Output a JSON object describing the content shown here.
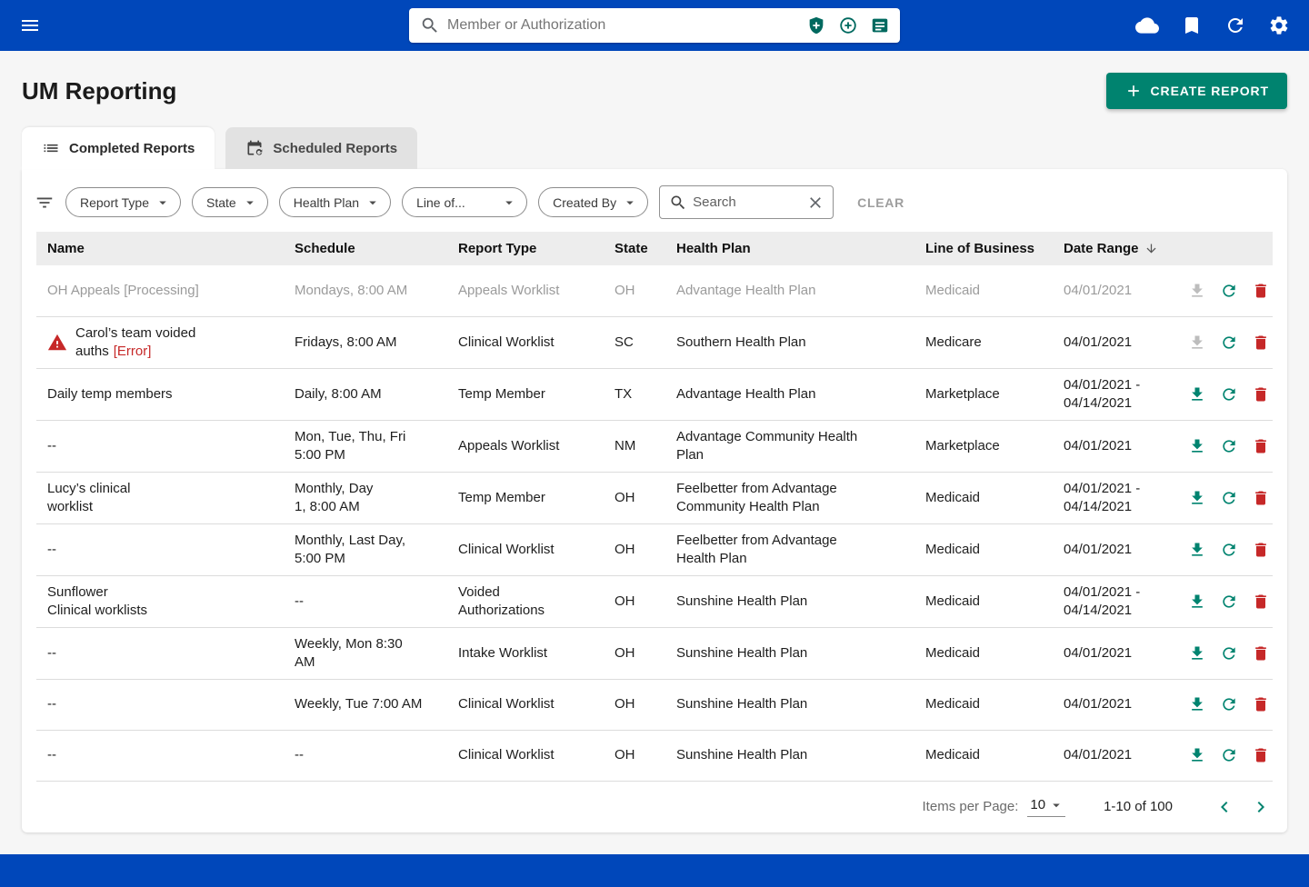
{
  "colors": {
    "topbar_blue": "#0047BA",
    "accent_green": "#00836F",
    "danger_red": "#C62828"
  },
  "topbar": {
    "search_placeholder": "Member or Authorization"
  },
  "page": {
    "title": "UM Reporting",
    "create_report_label": "CREATE REPORT"
  },
  "tabs": [
    {
      "label": "Completed Reports",
      "active": true
    },
    {
      "label": "Scheduled Reports",
      "active": false
    }
  ],
  "filters": {
    "pills": [
      "Report Type",
      "State",
      "Health Plan",
      "Line of...",
      "Created By"
    ],
    "search_placeholder": "Search",
    "clear_label": "CLEAR"
  },
  "table": {
    "headers": [
      "Name",
      "Schedule",
      "Report Type",
      "State",
      "Health Plan",
      "Line of Business",
      "Date Range"
    ],
    "rows": [
      {
        "name": "OH Appeals [Processing]",
        "error_label": "",
        "warning": false,
        "muted": true,
        "schedule": "Mondays, 8:00 AM",
        "report_type": "Appeals Worklist",
        "state": "OH",
        "health_plan": "Advantage Health Plan",
        "lob": "Medicaid",
        "date_range": "04/01/2021",
        "download_enabled": false
      },
      {
        "name": "Carol’s team voided\nauths",
        "error_label": "[Error]",
        "warning": true,
        "muted": false,
        "schedule": "Fridays, 8:00 AM",
        "report_type": "Clinical Worklist",
        "state": "SC",
        "health_plan": "Southern Health Plan",
        "lob": "Medicare",
        "date_range": "04/01/2021",
        "download_enabled": false
      },
      {
        "name": "Daily temp members",
        "error_label": "",
        "warning": false,
        "muted": false,
        "schedule": "Daily, 8:00 AM",
        "report_type": "Temp Member",
        "state": "TX",
        "health_plan": "Advantage Health Plan",
        "lob": "Marketplace",
        "date_range": "04/01/2021 -\n04/14/2021",
        "download_enabled": true
      },
      {
        "name": "--",
        "error_label": "",
        "warning": false,
        "muted": false,
        "schedule": "Mon, Tue, Thu, Fri\n5:00 PM",
        "report_type": "Appeals Worklist",
        "state": "NM",
        "health_plan": "Advantage Community Health\nPlan",
        "lob": "Marketplace",
        "date_range": "04/01/2021",
        "download_enabled": true
      },
      {
        "name": "Lucy’s clinical\nworklist",
        "error_label": "",
        "warning": false,
        "muted": false,
        "schedule": "Monthly, Day\n1, 8:00 AM",
        "report_type": "Temp Member",
        "state": "OH",
        "health_plan": "Feelbetter from Advantage\nCommunity Health Plan",
        "lob": "Medicaid",
        "date_range": "04/01/2021 -\n04/14/2021",
        "download_enabled": true
      },
      {
        "name": "--",
        "error_label": "",
        "warning": false,
        "muted": false,
        "schedule": "Monthly, Last Day,\n5:00 PM",
        "report_type": "Clinical Worklist",
        "state": "OH",
        "health_plan": "Feelbetter from Advantage\nHealth Plan",
        "lob": "Medicaid",
        "date_range": "04/01/2021",
        "download_enabled": true
      },
      {
        "name": "Sunflower\nClinical worklists",
        "error_label": "",
        "warning": false,
        "muted": false,
        "schedule": "--",
        "report_type": "Voided\nAuthorizations",
        "state": "OH",
        "health_plan": "Sunshine Health Plan",
        "lob": "Medicaid",
        "date_range": "04/01/2021 -\n04/14/2021",
        "download_enabled": true
      },
      {
        "name": "--",
        "error_label": "",
        "warning": false,
        "muted": false,
        "schedule": "Weekly, Mon 8:30\nAM",
        "report_type": "Intake Worklist",
        "state": "OH",
        "health_plan": "Sunshine Health Plan",
        "lob": "Medicaid",
        "date_range": "04/01/2021",
        "download_enabled": true
      },
      {
        "name": "--",
        "error_label": "",
        "warning": false,
        "muted": false,
        "schedule": "Weekly, Tue 7:00 AM",
        "report_type": "Clinical Worklist",
        "state": "OH",
        "health_plan": "Sunshine Health Plan",
        "lob": "Medicaid",
        "date_range": "04/01/2021",
        "download_enabled": true
      },
      {
        "name": "--",
        "error_label": "",
        "warning": false,
        "muted": false,
        "schedule": "--",
        "report_type": "Clinical Worklist",
        "state": "OH",
        "health_plan": "Sunshine Health Plan",
        "lob": "Medicaid",
        "date_range": "04/01/2021",
        "download_enabled": true
      }
    ]
  },
  "pagination": {
    "items_per_page_label": "Items per Page:",
    "items_per_page_value": "10",
    "range_label": "1-10 of 100"
  }
}
